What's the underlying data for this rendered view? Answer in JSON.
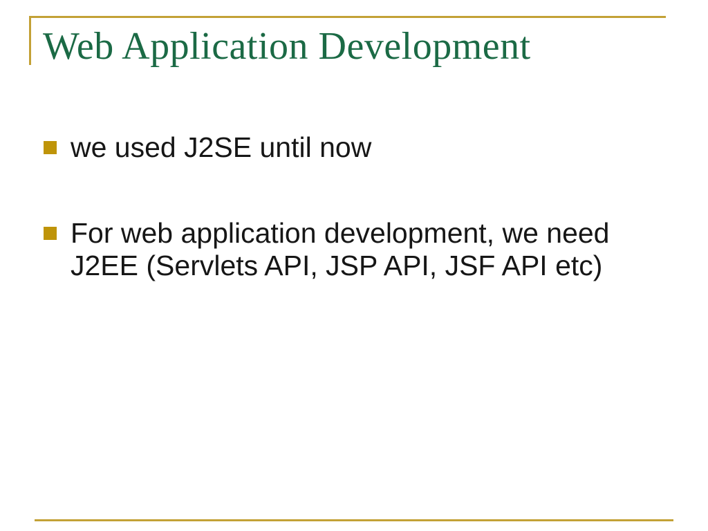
{
  "slide": {
    "title": "Web Application Development",
    "bullets": [
      {
        "lines": [
          "we used J2SE until now"
        ]
      },
      {
        "lines": [
          "For web application development, we need",
          "J2EE (Servlets API, JSP API, JSF API etc)"
        ]
      }
    ],
    "colors": {
      "background": "#FFFFFF",
      "accent_gold": "#C3A136",
      "bullet_gold": "#BF9409",
      "title_green": "#1B6A45",
      "body_text": "#161616"
    }
  }
}
